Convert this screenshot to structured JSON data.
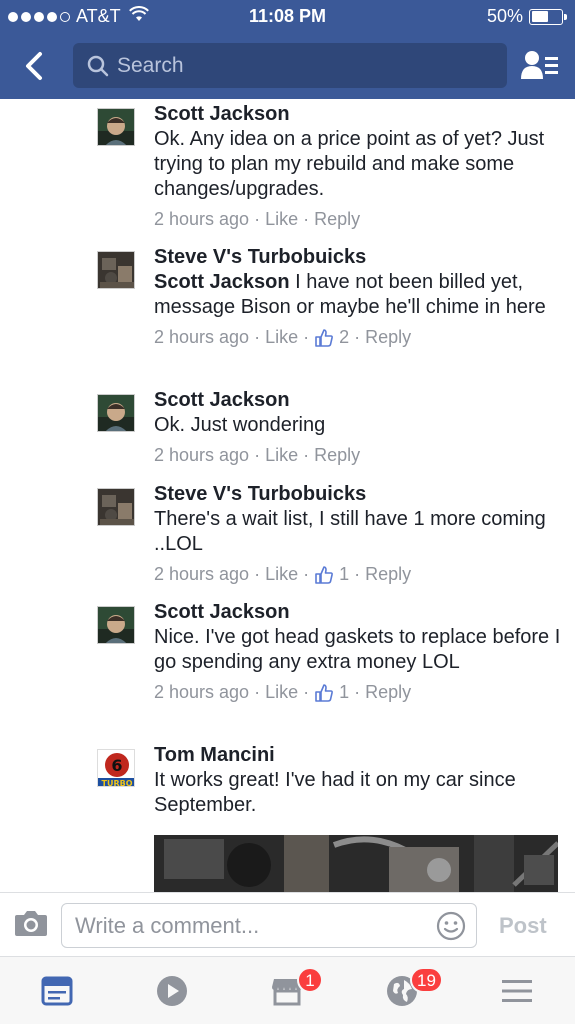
{
  "status_bar": {
    "carrier": "AT&T",
    "time": "11:08 PM",
    "battery": "50%",
    "battery_level": 0.5
  },
  "nav": {
    "search_placeholder": "Search"
  },
  "comments": [
    {
      "author": "Scott Jackson",
      "mention": "",
      "text": "Ok. Any idea on a price point as of yet? Just trying to plan my rebuild and make some changes/upgrades.",
      "time": "2 hours ago",
      "like_label": "Like",
      "reply_label": "Reply",
      "like_count": ""
    },
    {
      "author": "Steve V's Turbobuicks",
      "mention": "Scott Jackson",
      "text": "I have not been billed yet, message Bison or maybe he'll chime in here",
      "time": "2 hours ago",
      "like_label": "Like",
      "reply_label": "Reply",
      "like_count": "2"
    },
    {
      "author": "Scott Jackson",
      "mention": "",
      "text": "Ok. Just wondering",
      "time": "2 hours ago",
      "like_label": "Like",
      "reply_label": "Reply",
      "like_count": ""
    },
    {
      "author": "Steve V's Turbobuicks",
      "mention": "",
      "text": "There's a wait list, I still have 1 more coming ..LOL",
      "time": "2 hours ago",
      "like_label": "Like",
      "reply_label": "Reply",
      "like_count": "1"
    },
    {
      "author": "Scott Jackson",
      "mention": "",
      "text": "Nice. I've got head gaskets to replace before I go spending any extra money LOL",
      "time": "2 hours ago",
      "like_label": "Like",
      "reply_label": "Reply",
      "like_count": "1"
    },
    {
      "author": "Tom Mancini",
      "mention": "",
      "text": "It works great! I've had it on my car since September.",
      "avatar_text": "TURBO"
    }
  ],
  "composer": {
    "placeholder": "Write a comment...",
    "post_label": "Post"
  },
  "tabs": {
    "marketplace_badge": "1",
    "notifications_badge": "19"
  },
  "colors": {
    "brand_blue": "#3b5998",
    "active_tab": "#4267b2",
    "badge_red": "#fa3e3e"
  }
}
